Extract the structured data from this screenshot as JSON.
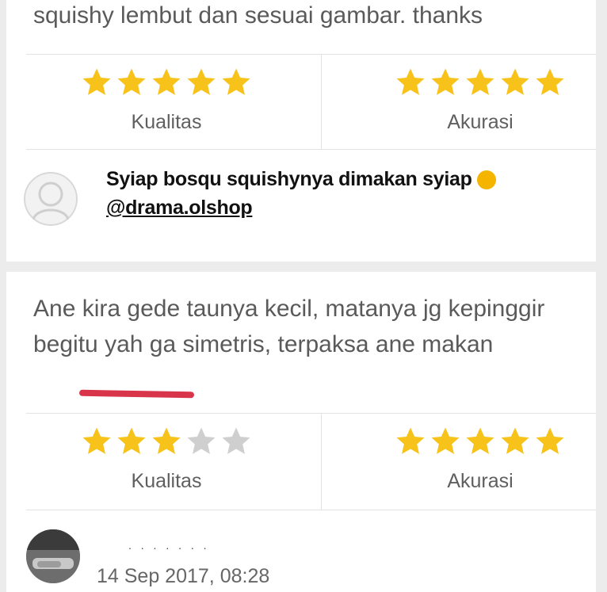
{
  "reviews": [
    {
      "text": "squishy lembut dan sesuai gambar. thanks",
      "ratings": [
        {
          "label": "Kualitas",
          "stars": 5,
          "max": 5
        },
        {
          "label": "Akurasi",
          "stars": 5,
          "max": 5
        }
      ],
      "seller_reply": {
        "line1": "Syiap bosqu squishynya dimakan syiap",
        "mention": "@drama.olshop"
      }
    },
    {
      "text": "Ane kira gede taunya kecil, matanya jg kepinggir begitu yah ga simetris, terpaksa ane makan",
      "ratings": [
        {
          "label": "Kualitas",
          "stars": 3,
          "max": 5
        },
        {
          "label": "Akurasi",
          "stars": 5,
          "max": 5
        }
      ]
    }
  ],
  "next_reviewer": {
    "name": ". . .  . . . .",
    "date": "14 Sep 2017, 08:28"
  },
  "colors": {
    "star_filled": "#f7c21a",
    "star_empty": "#cfcfcf",
    "highlight": "#d8354b"
  }
}
